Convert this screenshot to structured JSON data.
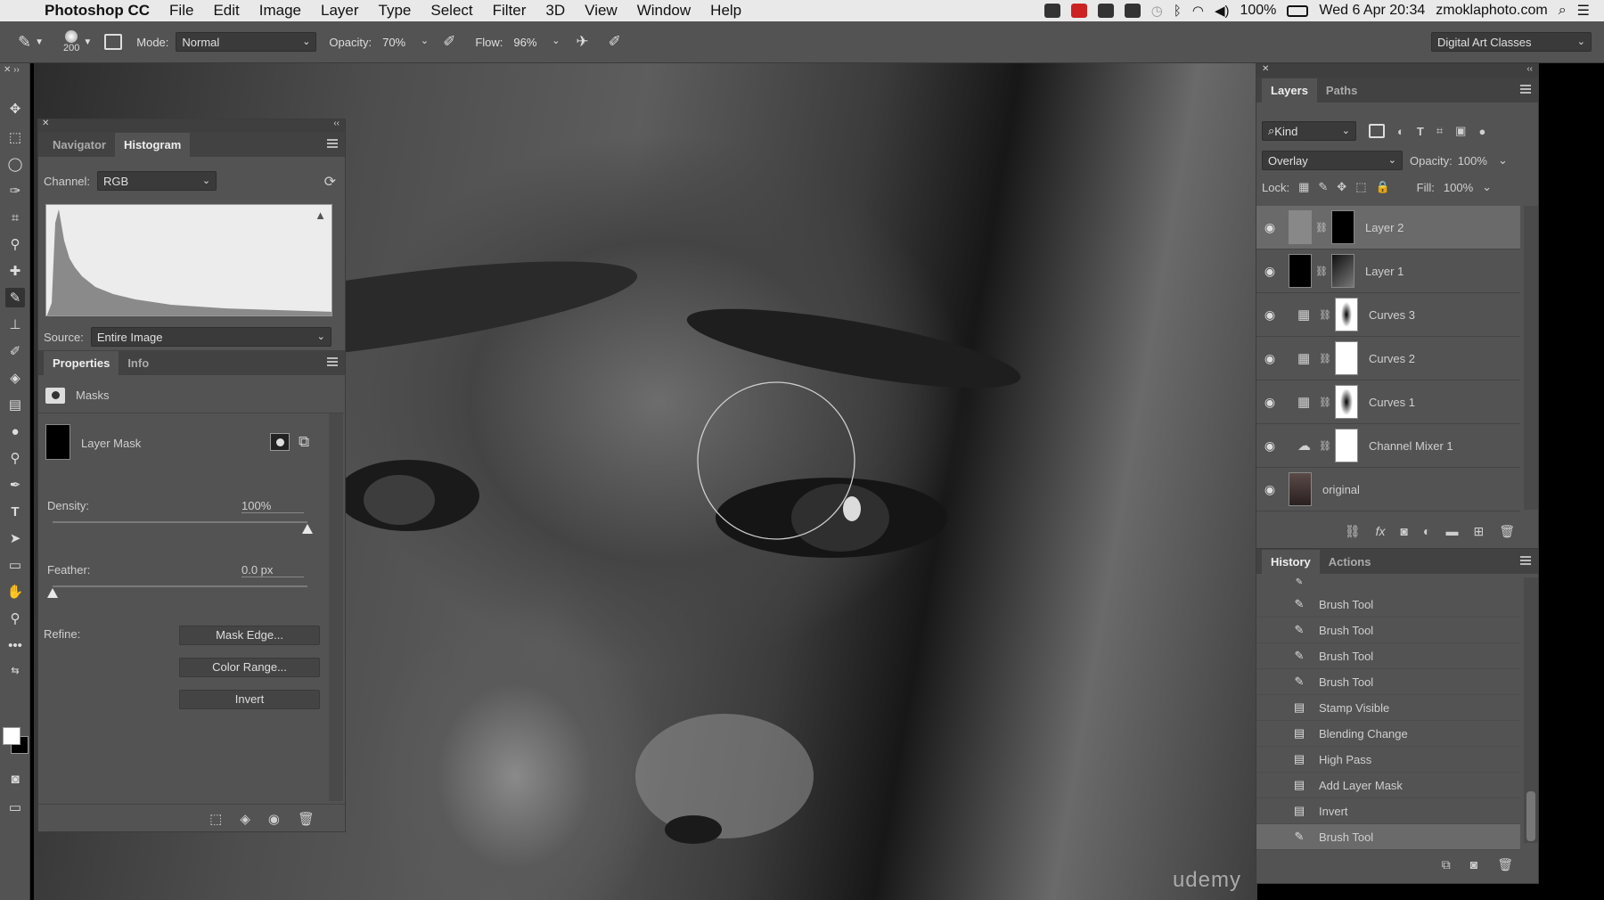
{
  "menubar": {
    "app": "Photoshop CC",
    "items": [
      "File",
      "Edit",
      "Image",
      "Layer",
      "Type",
      "Select",
      "Filter",
      "3D",
      "View",
      "Window",
      "Help"
    ],
    "battery": "100%",
    "datetime": "Wed 6 Apr  20:34",
    "site": "zmoklaphoto.com"
  },
  "options": {
    "brush_size": "200",
    "mode_label": "Mode:",
    "mode_value": "Normal",
    "opacity_label": "Opacity:",
    "opacity_value": "70%",
    "flow_label": "Flow:",
    "flow_value": "96%",
    "workspace": "Digital Art Classes"
  },
  "histogram_panel": {
    "tabs": [
      "Navigator",
      "Histogram"
    ],
    "channel_label": "Channel:",
    "channel_value": "RGB",
    "source_label": "Source:",
    "source_value": "Entire Image"
  },
  "properties_panel": {
    "tabs": [
      "Properties",
      "Info"
    ],
    "section": "Masks",
    "mask_name": "Layer Mask",
    "density_label": "Density:",
    "density_value": "100%",
    "density_level": 1.0,
    "feather_label": "Feather:",
    "feather_value": "0.0 px",
    "feather_level": 0.0,
    "refine_label": "Refine:",
    "btn_mask_edge": "Mask Edge...",
    "btn_color_range": "Color Range...",
    "btn_invert": "Invert"
  },
  "layers_panel": {
    "tabs": [
      "Layers",
      "Paths"
    ],
    "kind": "Kind",
    "blend_mode": "Overlay",
    "opacity_label": "Opacity:",
    "opacity_value": "100%",
    "lock_label": "Lock:",
    "fill_label": "Fill:",
    "fill_value": "100%",
    "layers": [
      "Layer 2",
      "Layer 1",
      "Curves 3",
      "Curves 2",
      "Curves 1",
      "Channel Mixer 1",
      "original"
    ]
  },
  "history_panel": {
    "tabs": [
      "History",
      "Actions"
    ],
    "items": [
      "Brush Tool",
      "Brush Tool",
      "Brush Tool",
      "Brush Tool",
      "Stamp Visible",
      "Blending Change",
      "High Pass",
      "Add Layer Mask",
      "Invert",
      "Brush Tool"
    ]
  },
  "watermark": "udemy",
  "colors": {
    "panel_bg": "#535353",
    "panel_dark": "#424242",
    "selected_row": "#6a6a6a"
  }
}
